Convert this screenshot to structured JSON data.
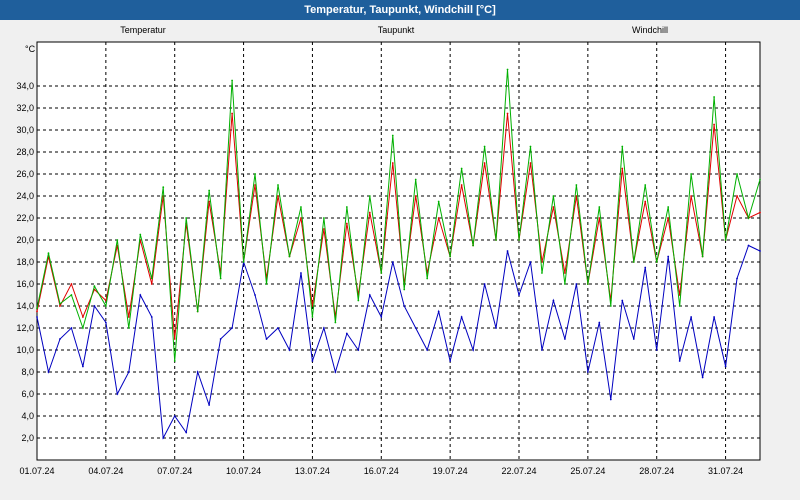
{
  "window": {
    "title": "Temperatur, Taupunkt, Windchill [°C]"
  },
  "chart_data": {
    "type": "line",
    "title": "Temperatur, Taupunkt, Windchill [°C]",
    "ylabel": "°C",
    "ylim": [
      0,
      38
    ],
    "yticks": [
      2.0,
      4.0,
      6.0,
      8.0,
      10.0,
      12.0,
      14.0,
      16.0,
      18.0,
      20.0,
      22.0,
      24.0,
      26.0,
      28.0,
      30.0,
      32.0,
      34.0
    ],
    "ytick_labels": [
      "2,0",
      "4,0",
      "6,0",
      "8,0",
      "10,0",
      "12,0",
      "14,0",
      "16,0",
      "18,0",
      "20,0",
      "22,0",
      "24,0",
      "26,0",
      "28,0",
      "30,0",
      "32,0",
      "34,0"
    ],
    "xlim": [
      "2024-07-01",
      "2024-08-01 12:00"
    ],
    "xtick_labels": [
      "01.07.24",
      "04.07.24",
      "07.07.24",
      "10.07.24",
      "13.07.24",
      "16.07.24",
      "19.07.24",
      "22.07.24",
      "25.07.24",
      "28.07.24",
      "31.07.24"
    ],
    "grid": true,
    "legend": "top",
    "x": [
      "2024-07-01",
      "2024-07-01 12:00",
      "2024-07-02",
      "2024-07-02 12:00",
      "2024-07-03",
      "2024-07-03 12:00",
      "2024-07-04",
      "2024-07-04 12:00",
      "2024-07-05",
      "2024-07-05 12:00",
      "2024-07-06",
      "2024-07-06 12:00",
      "2024-07-07",
      "2024-07-07 12:00",
      "2024-07-08",
      "2024-07-08 12:00",
      "2024-07-09",
      "2024-07-09 12:00",
      "2024-07-10",
      "2024-07-10 12:00",
      "2024-07-11",
      "2024-07-11 12:00",
      "2024-07-12",
      "2024-07-12 12:00",
      "2024-07-13",
      "2024-07-13 12:00",
      "2024-07-14",
      "2024-07-14 12:00",
      "2024-07-15",
      "2024-07-15 12:00",
      "2024-07-16",
      "2024-07-16 12:00",
      "2024-07-17",
      "2024-07-17 12:00",
      "2024-07-18",
      "2024-07-18 12:00",
      "2024-07-19",
      "2024-07-19 12:00",
      "2024-07-20",
      "2024-07-20 12:00",
      "2024-07-21",
      "2024-07-21 12:00",
      "2024-07-22",
      "2024-07-22 12:00",
      "2024-07-23",
      "2024-07-23 12:00",
      "2024-07-24",
      "2024-07-24 12:00",
      "2024-07-25",
      "2024-07-25 12:00",
      "2024-07-26",
      "2024-07-26 12:00",
      "2024-07-27",
      "2024-07-27 12:00",
      "2024-07-28",
      "2024-07-28 12:00",
      "2024-07-29",
      "2024-07-29 12:00",
      "2024-07-30",
      "2024-07-30 12:00",
      "2024-07-31",
      "2024-07-31 12:00",
      "2024-08-01",
      "2024-08-01 12:00"
    ],
    "series": [
      {
        "name": "Temperatur",
        "color": "#e00000",
        "values": [
          13.5,
          18.5,
          14.0,
          16.0,
          13.0,
          15.5,
          14.5,
          19.5,
          13.0,
          20.0,
          16.0,
          24.0,
          11.0,
          21.5,
          13.5,
          23.5,
          17.0,
          31.5,
          18.0,
          25.0,
          16.5,
          24.0,
          18.5,
          22.0,
          14.0,
          21.0,
          13.0,
          21.5,
          15.0,
          22.5,
          17.0,
          27.0,
          16.0,
          24.0,
          17.0,
          22.0,
          18.5,
          25.0,
          19.5,
          27.0,
          20.0,
          31.5,
          20.0,
          27.0,
          18.0,
          23.0,
          17.0,
          24.0,
          16.0,
          22.0,
          14.5,
          26.5,
          18.0,
          23.5,
          18.0,
          22.0,
          15.0,
          24.0,
          18.5,
          30.5,
          20.0,
          24.0,
          22.0,
          22.5
        ]
      },
      {
        "name": "Taupunkt",
        "color": "#0000c0",
        "values": [
          13.0,
          8.0,
          11.0,
          12.0,
          8.5,
          14.0,
          12.5,
          6.0,
          8.0,
          15.0,
          13.0,
          2.0,
          4.0,
          2.5,
          8.0,
          5.0,
          11.0,
          12.0,
          18.0,
          15.0,
          11.0,
          12.0,
          10.0,
          17.0,
          9.0,
          12.0,
          8.0,
          11.5,
          10.0,
          15.0,
          13.0,
          18.0,
          14.0,
          12.0,
          10.0,
          13.5,
          9.0,
          13.0,
          10.0,
          16.0,
          12.0,
          19.0,
          15.0,
          18.0,
          10.0,
          14.5,
          11.0,
          16.0,
          8.0,
          12.5,
          5.5,
          14.5,
          11.0,
          17.5,
          10.0,
          18.5,
          9.0,
          13.0,
          7.5,
          13.0,
          8.5,
          16.5,
          19.5,
          19.0
        ]
      },
      {
        "name": "Windchill",
        "color": "#00b000",
        "values": [
          13.8,
          18.8,
          14.2,
          15.0,
          12.0,
          15.8,
          14.0,
          20.0,
          12.0,
          20.5,
          16.5,
          24.8,
          9.0,
          22.0,
          13.5,
          24.5,
          16.5,
          34.5,
          18.0,
          26.0,
          16.0,
          25.0,
          18.5,
          23.0,
          13.0,
          22.0,
          12.5,
          23.0,
          14.5,
          24.0,
          17.0,
          29.5,
          15.5,
          25.5,
          16.5,
          23.5,
          18.5,
          26.5,
          19.5,
          28.5,
          20.0,
          35.5,
          20.0,
          28.5,
          17.0,
          24.0,
          16.0,
          25.0,
          16.0,
          23.0,
          14.0,
          28.5,
          18.0,
          25.0,
          18.0,
          23.0,
          14.0,
          26.0,
          18.5,
          33.0,
          20.0,
          26.0,
          22.0,
          25.5
        ]
      }
    ]
  }
}
